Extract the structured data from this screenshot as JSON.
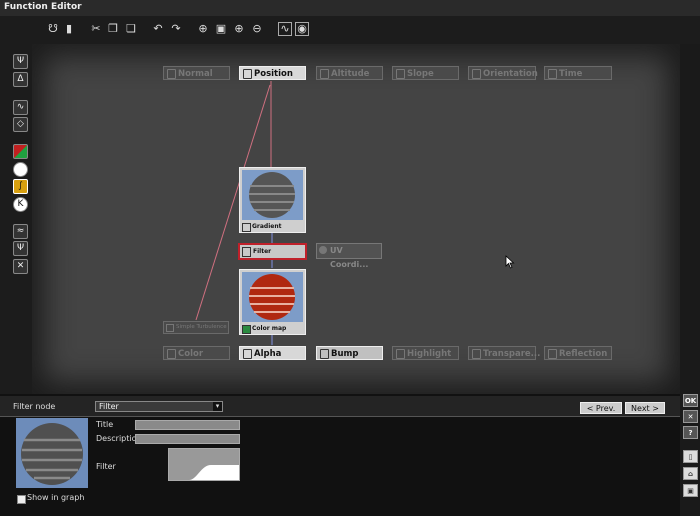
{
  "window": {
    "title": "Function Editor"
  },
  "input_slots": [
    {
      "label": "Normal",
      "active": false
    },
    {
      "label": "Position",
      "active": true
    },
    {
      "label": "Altitude",
      "active": false
    },
    {
      "label": "Slope",
      "active": false
    },
    {
      "label": "Orientation",
      "active": false
    },
    {
      "label": "Time",
      "active": false
    }
  ],
  "output_slots": [
    {
      "label": "Color",
      "active": false
    },
    {
      "label": "Alpha",
      "active": true
    },
    {
      "label": "Bump",
      "active": true
    },
    {
      "label": "Highlight",
      "active": false
    },
    {
      "label": "Transpare...",
      "active": false
    },
    {
      "label": "Reflection",
      "active": false
    }
  ],
  "nodes": {
    "gradient": "Gradient",
    "filter": "Filter",
    "uv": "UV Coordi...",
    "colormap": "Color map",
    "turbulence": "Simple Turbulence"
  },
  "panel": {
    "label": "Filter node",
    "type_value": "Filter",
    "prev": "< Prev.",
    "next": "Next >",
    "title_label": "Title",
    "description_label": "Description",
    "filter_label": "Filter",
    "show_in_graph": "Show in graph"
  },
  "right_buttons": {
    "ok": "OK",
    "close": "✕",
    "help": "?"
  }
}
